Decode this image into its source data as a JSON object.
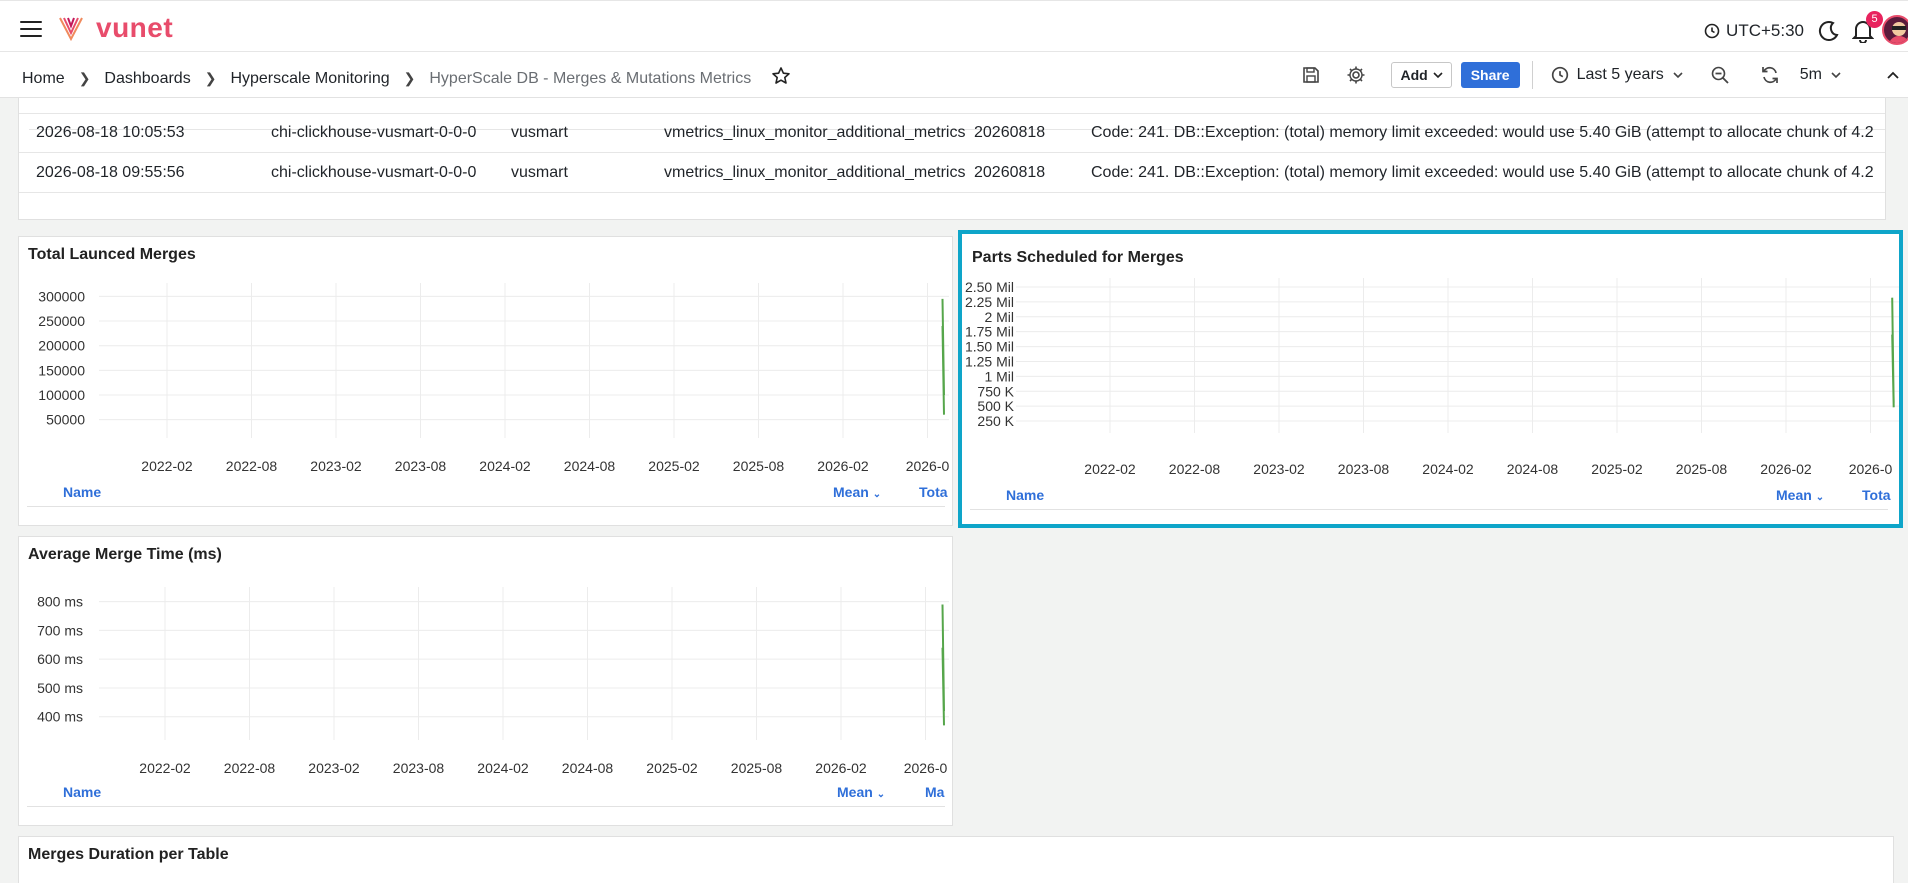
{
  "nav": {
    "brand": "vunet",
    "timezone": "UTC+5:30",
    "notification_count": "5"
  },
  "breadcrumb": {
    "items": [
      "Home",
      "Dashboards",
      "Hyperscale Monitoring",
      "HyperScale DB - Merges & Mutations Metrics"
    ]
  },
  "toolbar": {
    "add_label": "Add",
    "share_label": "Share",
    "time_range": "Last 5 years",
    "refresh_interval": "5m"
  },
  "table": {
    "rows": [
      [
        "2026-08-18 10:05:53",
        "chi-clickhouse-vusmart-0-0-0",
        "vusmart",
        "vmetrics_linux_monitor_additional_metrics",
        "20260818",
        "Code: 241. DB::Exception: (total) memory limit exceeded: would use 5.40 GiB (attempt to allocate chunk of 4.2"
      ],
      [
        "2026-08-18 09:55:56",
        "chi-clickhouse-vusmart-0-0-0",
        "vusmart",
        "vmetrics_linux_monitor_additional_metrics",
        "20260818",
        "Code: 241. DB::Exception: (total) memory limit exceeded: would use 5.40 GiB (attempt to allocate chunk of 4.2"
      ]
    ]
  },
  "panels": [
    {
      "title": "Total Launced Merges",
      "legend": {
        "name": "Name",
        "mean": "Mean",
        "total": "Tota"
      }
    },
    {
      "title": "Parts Scheduled for Merges",
      "legend": {
        "name": "Name",
        "mean": "Mean",
        "total": "Tota"
      }
    },
    {
      "title": "Average Merge Time (ms)",
      "legend": {
        "name": "Name",
        "mean": "Mean",
        "total": "Ma"
      }
    }
  ],
  "bottom_panel": {
    "title": "Merges Duration per Table"
  },
  "chart_data": [
    {
      "type": "line",
      "title": "Total Launced Merges",
      "x_ticks": [
        "2022-02",
        "2022-08",
        "2023-02",
        "2023-08",
        "2024-02",
        "2024-08",
        "2025-02",
        "2025-08",
        "2026-02",
        "2026-0"
      ],
      "y_ticks": [
        "300000",
        "250000",
        "200000",
        "150000",
        "100000",
        "50000"
      ],
      "y_tick_values": [
        300000,
        250000,
        200000,
        150000,
        100000,
        50000
      ],
      "ylim": [
        25000,
        315000
      ],
      "xlim": [
        "2021-09-01",
        "2026-09-01"
      ],
      "series": [
        {
          "color": "#56a64b",
          "x": [
            "2026-08-18",
            "2026-08-18",
            "2026-08-18",
            "2026-08-18"
          ],
          "y": [
            295000,
            100000,
            240000,
            60000
          ]
        }
      ]
    },
    {
      "type": "line",
      "title": "Parts Scheduled for Merges",
      "x_ticks": [
        "2022-02",
        "2022-08",
        "2023-02",
        "2023-08",
        "2024-02",
        "2024-08",
        "2025-02",
        "2025-08",
        "2026-02",
        "2026-0"
      ],
      "y_ticks": [
        "2.50 Mil",
        "2.25 Mil",
        "2 Mil",
        "1.75 Mil",
        "1.50 Mil",
        "1.25 Mil",
        "1 Mil",
        "750 K",
        "500 K",
        "250 K"
      ],
      "y_tick_values": [
        2500000,
        2250000,
        2000000,
        1750000,
        1500000,
        1250000,
        1000000,
        750000,
        500000,
        250000
      ],
      "ylim": [
        150000,
        2550000
      ],
      "xlim": [
        "2021-09-01",
        "2026-09-01"
      ],
      "series": [
        {
          "color": "#56a64b",
          "x": [
            "2026-08-18",
            "2026-08-18",
            "2026-08-18",
            "2026-08-18"
          ],
          "y": [
            2320000,
            480000,
            1700000,
            560000
          ]
        }
      ]
    },
    {
      "type": "line",
      "title": "Average Merge Time (ms)",
      "x_ticks": [
        "2022-02",
        "2022-08",
        "2023-02",
        "2023-08",
        "2024-02",
        "2024-08",
        "2025-02",
        "2025-08",
        "2026-02",
        "2026-0"
      ],
      "y_ticks": [
        "800 ms",
        "700 ms",
        "600 ms",
        "500 ms",
        "400 ms"
      ],
      "y_tick_values": [
        800,
        700,
        600,
        500,
        400
      ],
      "ylim": [
        340,
        830
      ],
      "xlim": [
        "2021-09-01",
        "2026-09-01"
      ],
      "series": [
        {
          "color": "#56a64b",
          "x": [
            "2026-08-18",
            "2026-08-18",
            "2026-08-18",
            "2026-08-18"
          ],
          "y": [
            790,
            420,
            640,
            370
          ]
        }
      ]
    }
  ]
}
